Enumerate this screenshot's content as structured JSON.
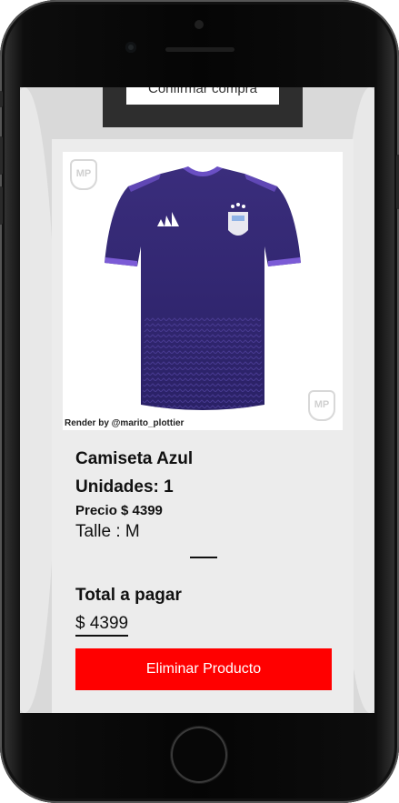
{
  "header": {
    "confirm_label": "Confirmar compra"
  },
  "product": {
    "image_credit": "Render by @marito_plottier",
    "watermark_text": "MP",
    "name": "Camiseta Azul",
    "units_text": "Unidades: 1",
    "price_text": "Precio $ 4399",
    "size_text": "Talle : M",
    "jersey_color": "#3b2f7e",
    "jersey_accent": "#7b5bd6"
  },
  "summary": {
    "total_label": "Total a pagar",
    "total_value": "$ 4399"
  },
  "actions": {
    "delete_label": "Eliminar Producto",
    "delete_color": "#ff0000"
  }
}
